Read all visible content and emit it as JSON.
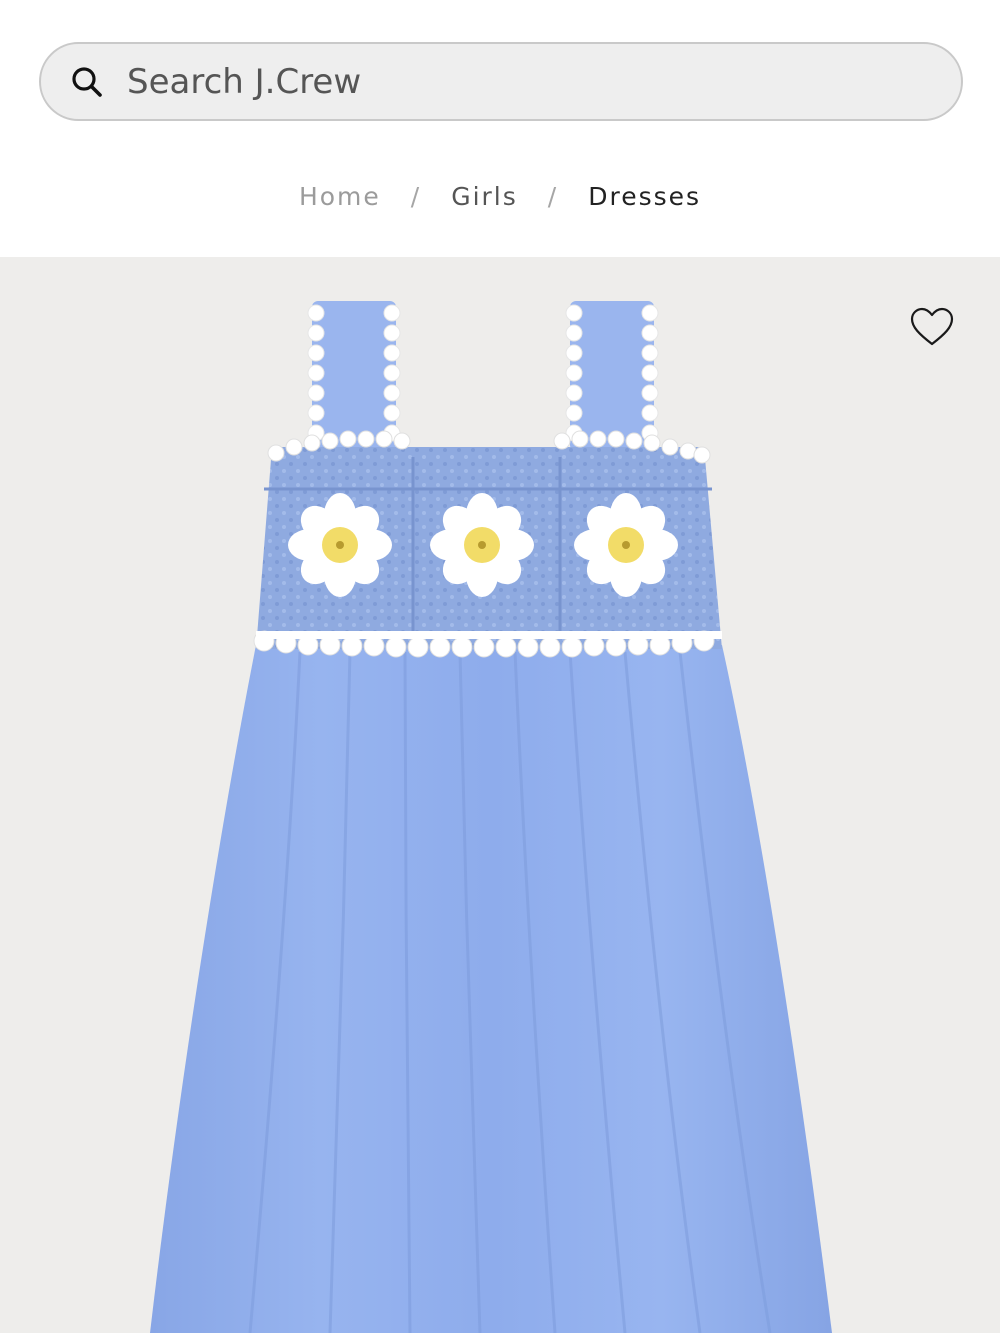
{
  "search": {
    "placeholder": "Search J.Crew",
    "icon": "search-icon"
  },
  "breadcrumb": {
    "items": [
      "Home",
      "Girls",
      "Dresses"
    ],
    "separator": "/"
  },
  "product": {
    "image": "crochet-daisy-dress",
    "wishlist_icon": "heart-outline-icon"
  },
  "colors": {
    "dress_blue": "#93b1ec",
    "bodice_blue": "#8faae0",
    "trim_white": "#ffffff",
    "daisy_center": "#f2dc68",
    "image_background": "#eeedeb"
  }
}
